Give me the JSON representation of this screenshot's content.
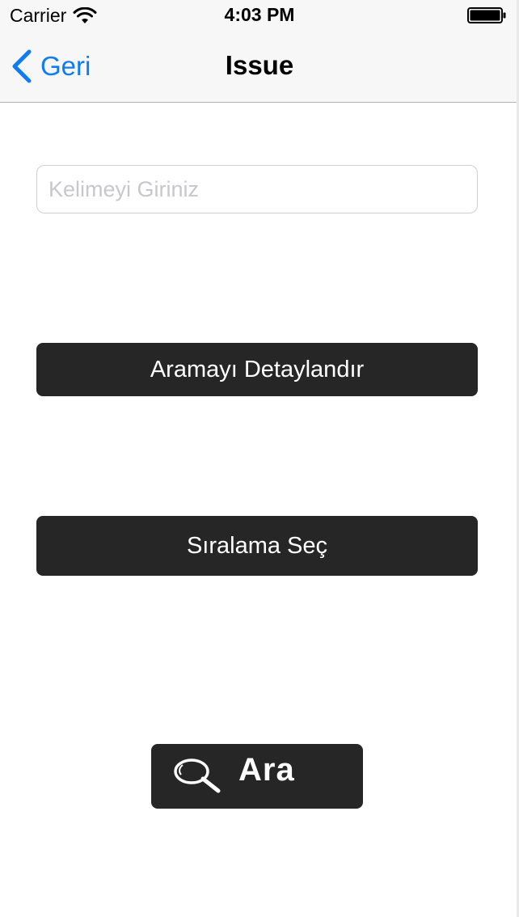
{
  "status_bar": {
    "carrier": "Carrier",
    "time": "4:03 PM",
    "wifi_icon": "wifi-icon",
    "battery_icon": "battery-icon",
    "battery_level": 1.0
  },
  "nav": {
    "back_label": "Geri",
    "back_icon": "chevron-left-icon",
    "title": "Issue",
    "accent_color": "#0f7cf5"
  },
  "search": {
    "value": "",
    "placeholder": "Kelimeyi Giriniz"
  },
  "buttons": {
    "detail_label": "Aramayı Detaylandır",
    "sort_label": "Sıralama Seç",
    "search_label": "Ara",
    "search_icon": "magnifier-icon",
    "button_color": "#262626"
  }
}
